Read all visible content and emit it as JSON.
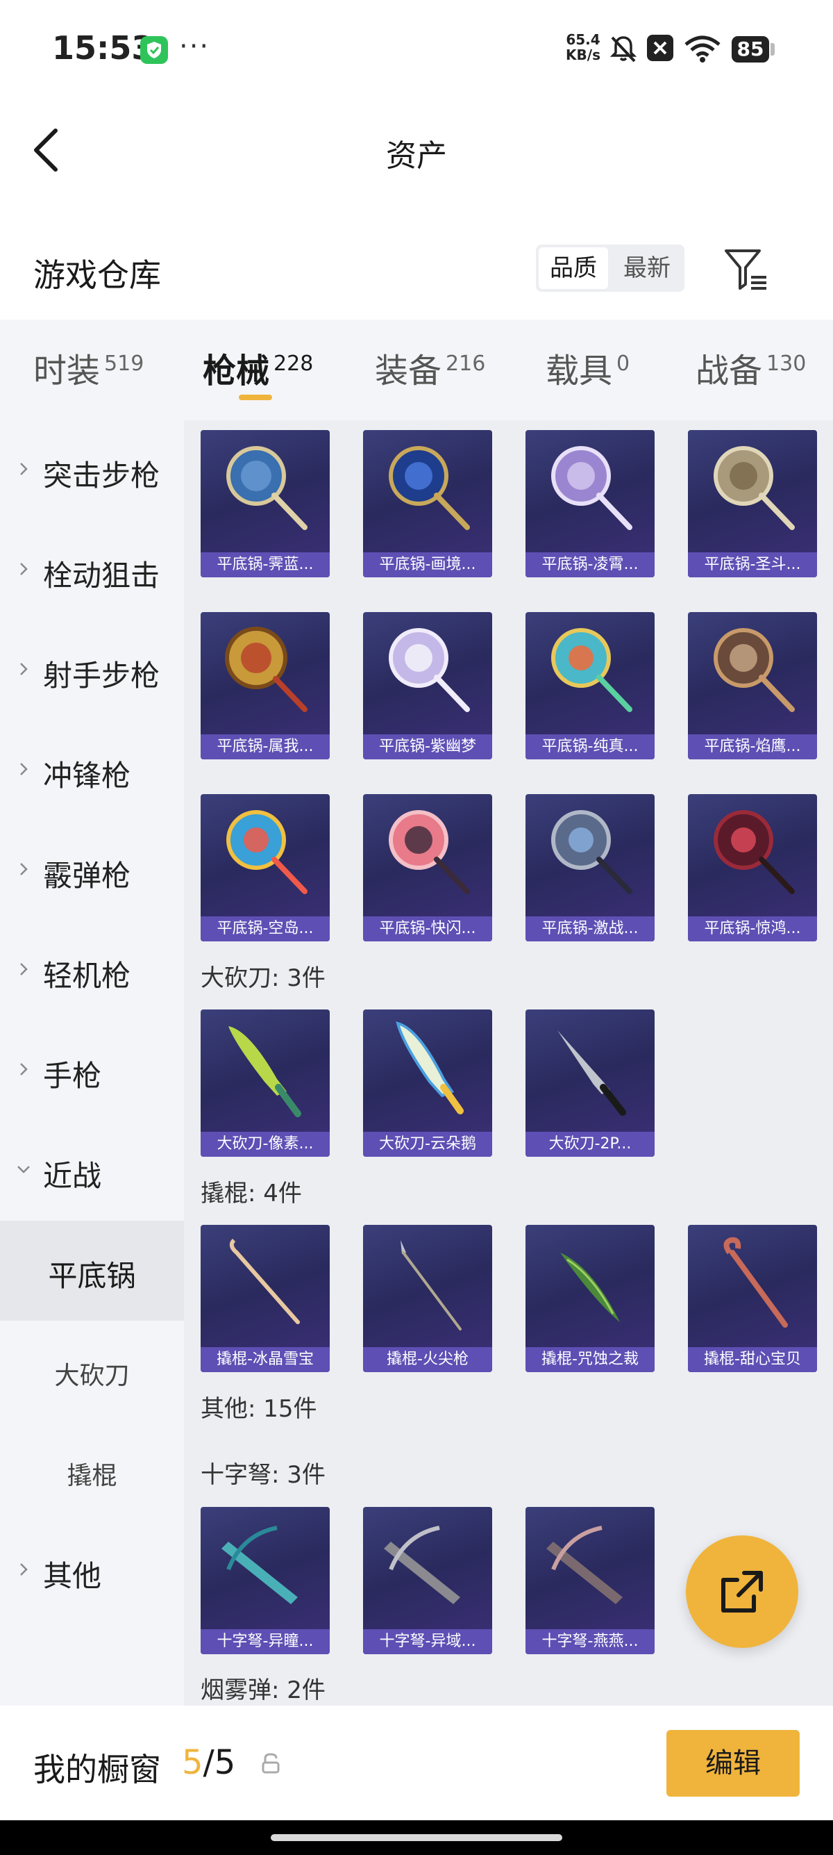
{
  "status_bar": {
    "time": "15:53",
    "more": "···",
    "net_speed_value": "65.4",
    "net_speed_unit": "KB/s",
    "battery": "85"
  },
  "header": {
    "title": "资产",
    "back_icon": "chevron-left-icon"
  },
  "warehouse": {
    "title": "游戏仓库",
    "sort_options": [
      "品质",
      "最新"
    ],
    "active_sort": "品质",
    "filter_icon": "filter-list-icon"
  },
  "tabs": [
    {
      "label": "时装",
      "count": "519"
    },
    {
      "label": "枪械",
      "count": "228"
    },
    {
      "label": "装备",
      "count": "216"
    },
    {
      "label": "载具",
      "count": "0"
    },
    {
      "label": "战备",
      "count": "130"
    }
  ],
  "active_tab": "枪械",
  "sidebar": {
    "categories": [
      "突击步枪",
      "栓动狙击",
      "射手步枪",
      "冲锋枪",
      "霰弹枪",
      "轻机枪",
      "手枪",
      "近战"
    ],
    "sub_items": [
      "平底锅",
      "大砍刀",
      "撬棍"
    ],
    "active_sub": "平底锅",
    "other": "其他"
  },
  "content": {
    "pans": [
      "平底锅-霁蓝...",
      "平底锅-画境...",
      "平底锅-凌霄...",
      "平底锅-圣斗...",
      "平底锅-属我...",
      "平底锅-紫幽梦",
      "平底锅-纯真...",
      "平底锅-焰鹰...",
      "平底锅-空岛...",
      "平底锅-快闪...",
      "平底锅-激战...",
      "平底锅-惊鸿..."
    ],
    "machete_title": "大砍刀: 3件",
    "machetes": [
      "大砍刀-像素...",
      "大砍刀-云朵鹅",
      "大砍刀-2P..."
    ],
    "crowbar_title": "撬棍: 4件",
    "crowbars": [
      "撬棍-冰晶雪宝",
      "撬棍-火尖枪",
      "撬棍-咒蚀之裁",
      "撬棍-甜心宝贝"
    ],
    "other_title": "其他: 15件",
    "crossbow_title": "十字弩: 3件",
    "crossbows": [
      "十字弩-异瞳...",
      "十字弩-异域...",
      "十字弩-燕燕..."
    ],
    "smoke_title": "烟雾弹: 2件"
  },
  "fab": {
    "icon": "share-external-icon"
  },
  "bottom_bar": {
    "label": "我的橱窗",
    "current": "5",
    "separator": "/",
    "total": "5",
    "lock_icon": "lock-open-icon",
    "edit_label": "编辑"
  },
  "colors": {
    "accent": "#f0b43c",
    "card_label_bg": "#5e4fb4",
    "card_bg": "#2a2a5e",
    "sidebar_bg": "#f4f5f8",
    "content_bg": "#eceef2"
  }
}
